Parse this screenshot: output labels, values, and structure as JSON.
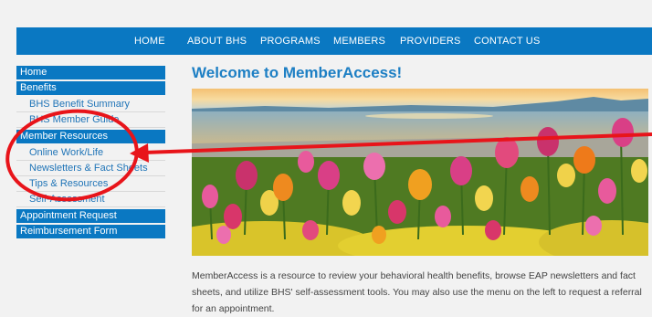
{
  "nav": [
    "HOME",
    "ABOUT BHS",
    "PROGRAMS",
    "MEMBERS",
    "PROVIDERS",
    "CONTACT US"
  ],
  "sidebar": {
    "home": "Home",
    "benefits": "Benefits",
    "benefit_summary": "BHS Benefit Summary",
    "member_guide": "BHS Member Guide",
    "member_resources": "Member Resources",
    "online_worklife": "Online Work/Life",
    "newsletters": "Newsletters & Fact Sheets",
    "tips": "Tips & Resources",
    "self_assessment": "Self-Assessment",
    "appointment": "Appointment Request",
    "reimbursement": "Reimbursement Form"
  },
  "main": {
    "title": "Welcome to MemberAccess!",
    "intro": "MemberAccess is a resource to review your behavioral health benefits, browse EAP newsletters and fact sheets, and utilize BHS' self-assessment tools. You may also use the menu on the left to request a referral for an appointment."
  },
  "colors": {
    "brand_blue": "#0a78c2",
    "link_blue": "#1f74b7",
    "annotation_red": "#e8141a"
  },
  "annotation": {
    "shape": "red circle around Member Resources with arrow pointing to Online Work/Life"
  }
}
